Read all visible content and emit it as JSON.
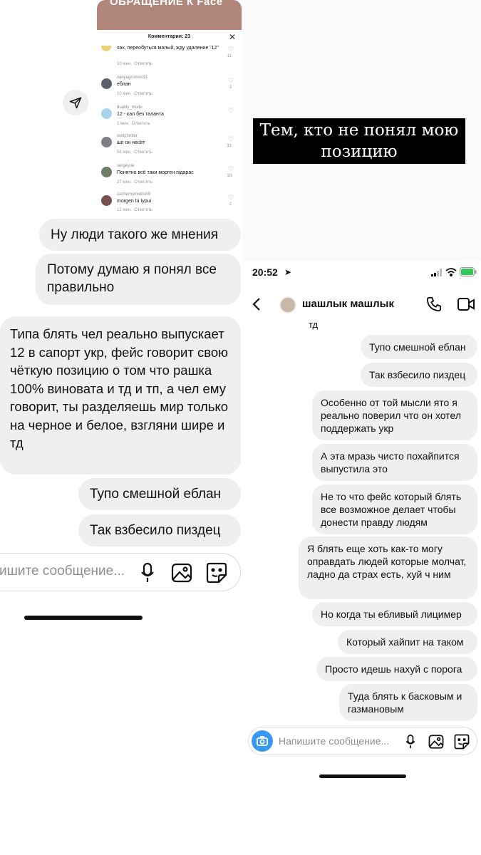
{
  "left": {
    "embed": {
      "title": "ОБРАЩЕНИЕ К Face",
      "comments_header": "Комментарии: 23",
      "comments": [
        {
          "user": "",
          "text": "хах, переобуться малый, жду удаление \"12\"",
          "time": "10 мин.",
          "reply": "Ответить",
          "likes": "11"
        },
        {
          "user": "vanyagromov33",
          "text": "еблан",
          "time": "10 мин.",
          "reply": "Ответить",
          "likes": "3"
        },
        {
          "user": "duality_mode",
          "text": "12 - кал без таланта",
          "time": "1 мин.",
          "reply": "Ответить",
          "likes": ""
        },
        {
          "user": "switchroter",
          "text": "шо он несёт",
          "time": "56 мин.",
          "reply": "Ответить",
          "likes": "31"
        },
        {
          "user": "sergey.te",
          "text": "Понятно всё таки морген пiдарас",
          "time": "27 мин.",
          "reply": "Ответить",
          "likes": "18"
        },
        {
          "user": "zachemsmotrish9",
          "text": "morgen tu typui",
          "time": "12 мин.",
          "reply": "Ответить",
          "likes": "2"
        }
      ]
    },
    "messages": [
      "Ну люди такого же мнения",
      "Потому думаю я понял все правильно",
      "Типа блять чел реально выпускает 12 в сапорт укр, фейс говорит свою чёткую позицию о том что рашка 100% виновата и тд и тп, а чел ему говорит, ты разделяешь мир только на черное и белое, взгляни шире и тд",
      "Тупо смешной еблан",
      "Так взбесило пиздец"
    ],
    "composer_placeholder": "ишите сообщение..."
  },
  "right": {
    "story_label": "Тем, кто не понял мою позицию",
    "status_time": "20:52",
    "chat_name": "шашлык машлык",
    "cut_text": "тд",
    "messages": [
      "Тупо смешной еблан",
      "Так взбесило пиздец",
      "Особенно от той мысли ято я реально поверил что он хотел поддержать укр",
      "А эта мразь чисто похайпится выпустила это",
      "Не то что фейс который блять все возможное делает чтобы донести правду людям",
      "Я блять еще хоть как-то могу оправдать людей которые молчат, ладно да страх есть, хуй ч ним",
      "Но когда ты ебливый лицимер",
      "Который хайпит на таком",
      "Просто идешь нахуй с порога",
      "Туда блять к басковым и газмановым"
    ],
    "composer_placeholder": "Напишите сообщение..."
  },
  "colors": {
    "bubble": "#efefef",
    "camera": "#3897f0",
    "battery": "#34c759"
  }
}
